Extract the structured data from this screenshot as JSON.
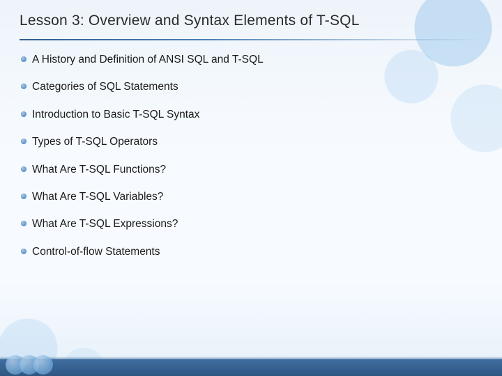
{
  "title": "Lesson 3: Overview and Syntax Elements of T-SQL",
  "bullets": [
    "A History and Definition of ANSI SQL and T-SQL",
    "Categories of SQL Statements",
    "Introduction to Basic T-SQL Syntax",
    "Types of T-SQL Operators",
    "What Are T-SQL Functions?",
    "What Are T-SQL Variables?",
    "What Are T-SQL Expressions?",
    "Control-of-flow Statements"
  ]
}
